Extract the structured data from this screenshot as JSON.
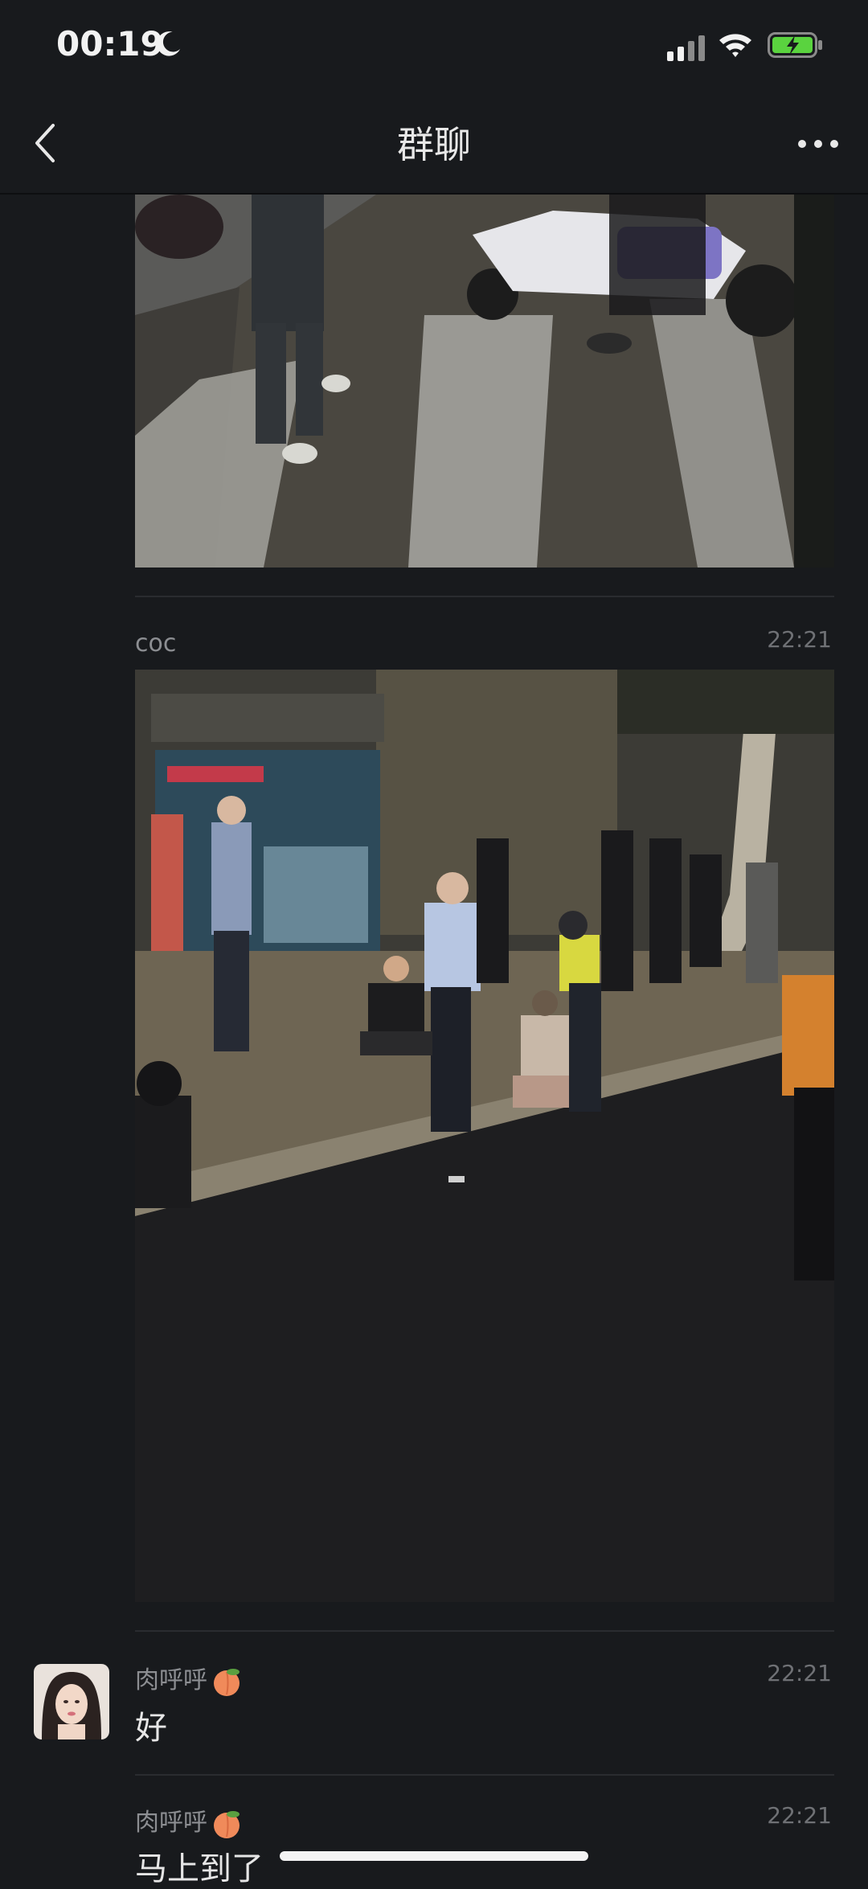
{
  "status": {
    "time": "00:19"
  },
  "nav": {
    "title": "群聊"
  },
  "messages": [
    {
      "sender": "coc",
      "time": "22:21"
    },
    {
      "sender": "肉呼呼",
      "time": "22:21",
      "text": "好"
    },
    {
      "sender": "肉呼呼",
      "time": "22:21",
      "text": "马上到了"
    }
  ],
  "colors": {
    "background": "#181a1d",
    "battery": "#5ad33f"
  }
}
